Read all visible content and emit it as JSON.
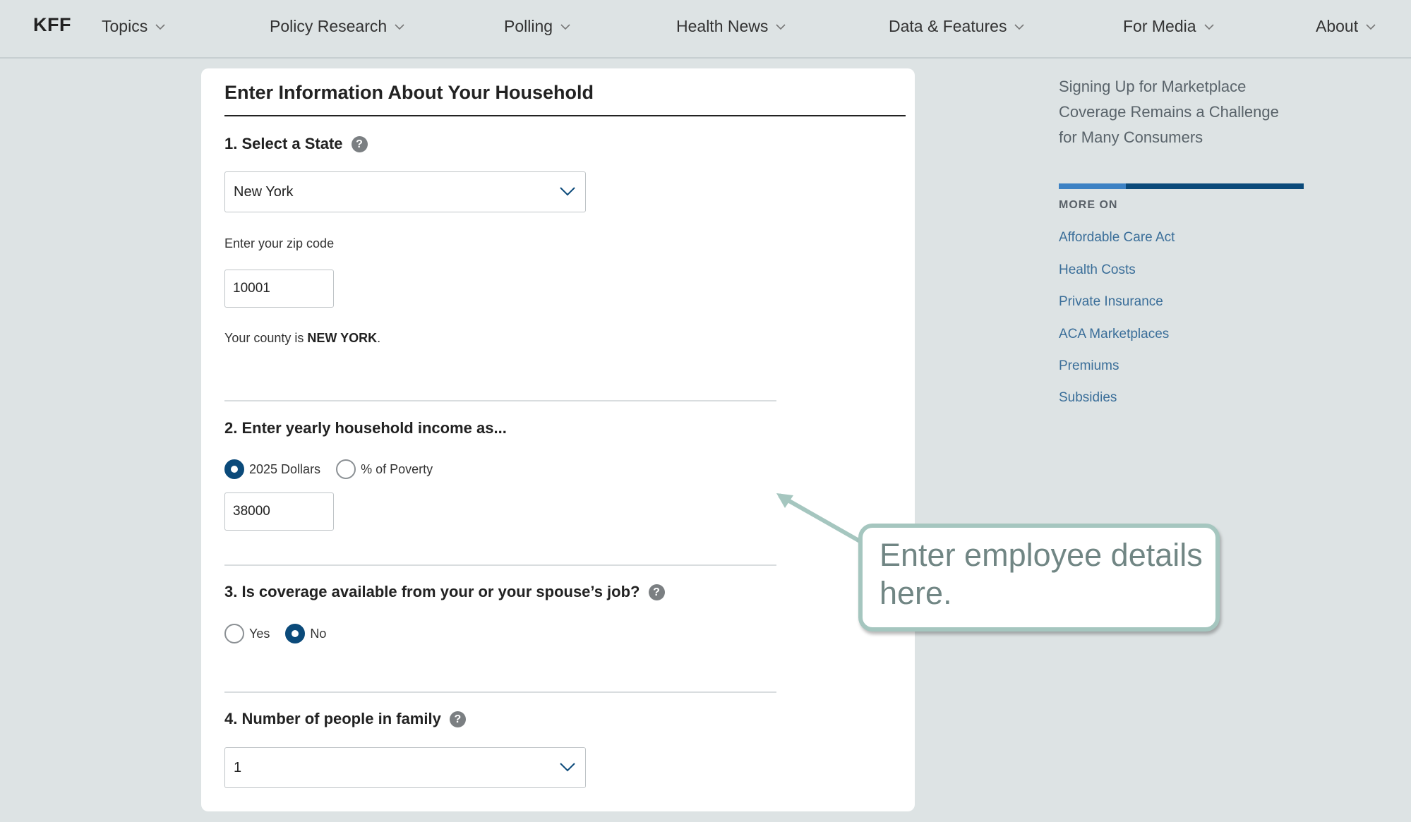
{
  "nav": {
    "logo": "KFF",
    "items": [
      "Topics",
      "Policy Research",
      "Polling",
      "Health News",
      "Data & Features",
      "For Media",
      "About"
    ]
  },
  "form": {
    "title": "Enter Information About Your Household",
    "q1": {
      "title": "1. Select a State",
      "state_value": "New York",
      "zip_label": "Enter your zip code",
      "zip_value": "10001",
      "county_prefix": "Your county is ",
      "county_name": "NEW YORK",
      "county_suffix": "."
    },
    "q2": {
      "title": "2. Enter yearly household income as...",
      "option_dollars": "2025 Dollars",
      "option_poverty": "% of Poverty",
      "selected": "2025 Dollars",
      "income_value": "38000"
    },
    "q3": {
      "title": "3. Is coverage available from your or your spouse’s job?",
      "option_yes": "Yes",
      "option_no": "No",
      "selected": "No"
    },
    "q4": {
      "title": "4. Number of people in family",
      "value": "1"
    },
    "help_glyph": "?"
  },
  "sidebar": {
    "article_title": "Signing Up for Marketplace Coverage Remains a Challenge for Many Consumers",
    "more_on_label": "MORE ON",
    "topics": [
      "Affordable Care Act",
      "Health Costs",
      "Private Insurance",
      "ACA Marketplaces",
      "Premiums",
      "Subsidies"
    ]
  },
  "callout": {
    "text": "Enter employee details here."
  },
  "colors": {
    "accent": "#0b4a7a",
    "link": "#3a6e99",
    "callout_border": "#a5c6bf"
  }
}
